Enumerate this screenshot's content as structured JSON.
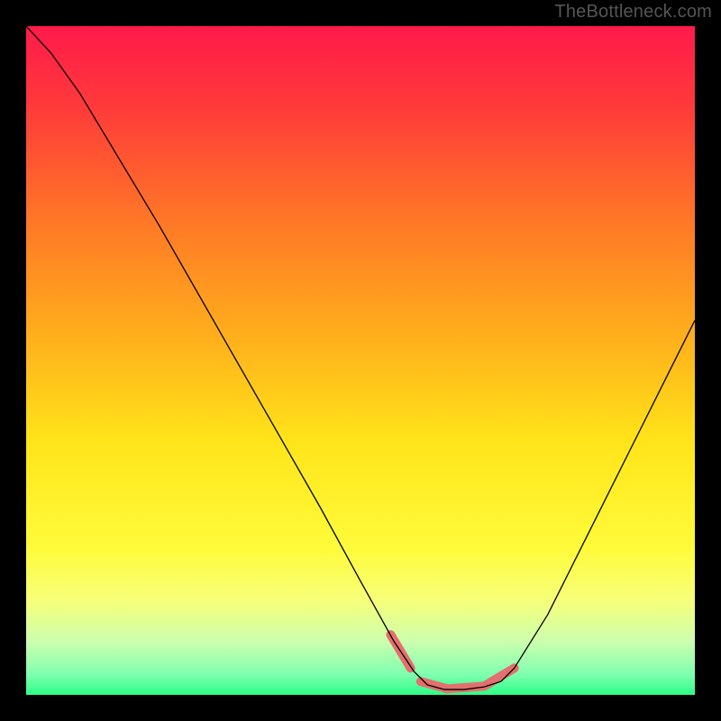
{
  "watermark": "TheBottleneck.com",
  "chart_data": {
    "type": "line",
    "title": "",
    "xlabel": "",
    "ylabel": "",
    "xlim": [
      0,
      100
    ],
    "ylim": [
      0,
      100
    ],
    "grid": false,
    "background_gradient": {
      "type": "vertical-red-yellow-green",
      "stops": [
        {
          "pos": 0.0,
          "color": "#ff1a4b"
        },
        {
          "pos": 0.12,
          "color": "#ff3a3a"
        },
        {
          "pos": 0.3,
          "color": "#ff7a26"
        },
        {
          "pos": 0.48,
          "color": "#ffb41b"
        },
        {
          "pos": 0.62,
          "color": "#ffe41a"
        },
        {
          "pos": 0.78,
          "color": "#fffb3a"
        },
        {
          "pos": 0.86,
          "color": "#f6ff7a"
        },
        {
          "pos": 0.92,
          "color": "#ccffae"
        },
        {
          "pos": 0.97,
          "color": "#7dffaf"
        },
        {
          "pos": 1.0,
          "color": "#2cff86"
        }
      ]
    },
    "series": [
      {
        "name": "bottleneck-curve",
        "stroke": "#000000",
        "stroke_width": 1.3,
        "x": [
          0.0,
          3.7,
          8.0,
          14.0,
          20.0,
          28.0,
          36.0,
          44.0,
          50.0,
          55.0,
          58.0,
          60.0,
          62.5,
          65.5,
          68.5,
          71.0,
          73.0,
          78.0,
          84.0,
          90.0,
          96.0,
          100.0
        ],
        "y": [
          100.0,
          96.0,
          90.0,
          80.0,
          70.0,
          56.0,
          42.0,
          28.0,
          17.0,
          8.0,
          3.5,
          1.5,
          0.8,
          0.8,
          1.2,
          2.0,
          4.0,
          12.0,
          24.0,
          36.0,
          48.0,
          56.0
        ]
      },
      {
        "name": "highlight-segments",
        "stroke": "#e46f6f",
        "stroke_width": 10,
        "linecap": "round",
        "segments": [
          {
            "x": [
              54.5,
              57.5
            ],
            "y": [
              9.0,
              4.0
            ]
          },
          {
            "x": [
              59.0,
              63.0
            ],
            "y": [
              2.0,
              0.9
            ]
          },
          {
            "x": [
              63.0,
              68.5
            ],
            "y": [
              0.9,
              1.3
            ]
          },
          {
            "x": [
              68.5,
              73.0
            ],
            "y": [
              1.3,
              4.0
            ]
          }
        ]
      }
    ]
  }
}
